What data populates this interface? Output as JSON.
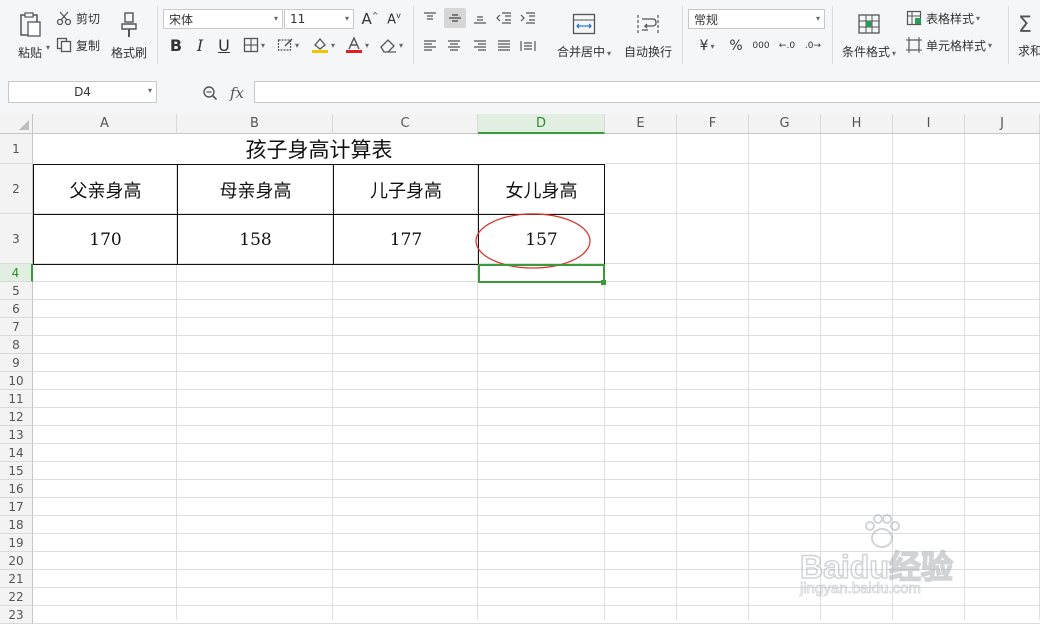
{
  "ribbon": {
    "paste": "粘贴",
    "cut": "剪切",
    "copy": "复制",
    "format_painter": "格式刷",
    "font_name": "宋体",
    "font_size": "11",
    "bold": "B",
    "italic": "I",
    "underline": "U",
    "merge_center": "合并居中",
    "wrap_text": "自动换行",
    "number_format": "常规",
    "currency": "¥",
    "percent": "%",
    "conditional_format": "条件格式",
    "table_style": "表格样式",
    "cell_style": "单元格样式",
    "sum": "求和"
  },
  "formula_bar": {
    "name_box": "D4",
    "fx": "fx",
    "formula": ""
  },
  "sheet": {
    "columns": [
      "A",
      "B",
      "C",
      "D",
      "E",
      "F",
      "G",
      "H",
      "I",
      "J"
    ],
    "rows": [
      "1",
      "2",
      "3",
      "4",
      "5",
      "6",
      "7",
      "8",
      "9",
      "10",
      "11",
      "12",
      "13",
      "14",
      "15",
      "16",
      "17",
      "18",
      "19",
      "20",
      "21",
      "22",
      "23"
    ],
    "selected_cell": "D4",
    "title": "孩子身高计算表",
    "headers": [
      "父亲身高",
      "母亲身高",
      "儿子身高",
      "女儿身高"
    ],
    "values": [
      "170",
      "158",
      "177",
      "157"
    ],
    "highlight_color": "#d93025",
    "selection_color": "#3a9b3a"
  },
  "watermark": {
    "brand": "Baidu经验",
    "url": "jingyan.baidu.com"
  }
}
